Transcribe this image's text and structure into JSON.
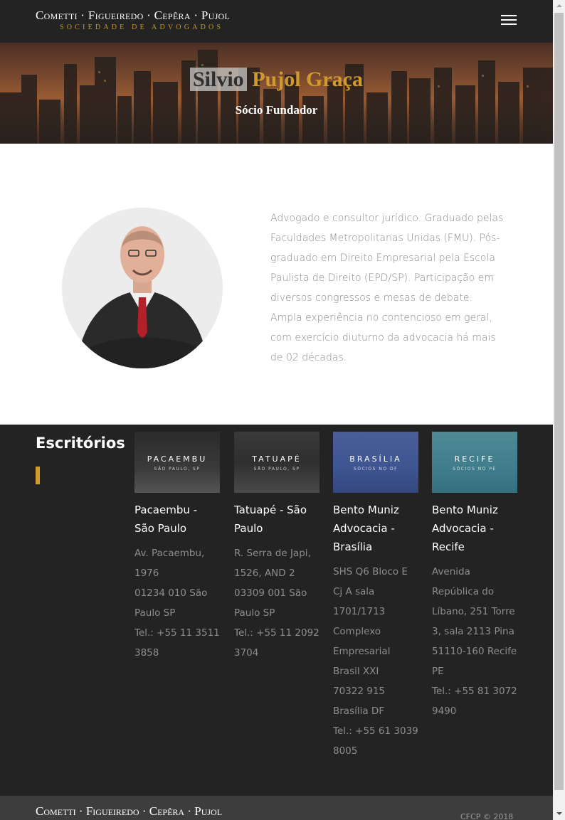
{
  "header": {
    "logo_name": "Cometti · Figueiredo · Cepêra · Pujol",
    "logo_sub": "Sociedade de Advogados",
    "menu_icon": "hamburger-menu-icon"
  },
  "hero": {
    "first_name": "Silvio",
    "last_name": "Pujol Graça",
    "subtitle": "Sócio Fundador"
  },
  "profile": {
    "bio": "Advogado e consultor jurídico. Graduado pelas Faculdades Metropolitanas Unidas (FMU). Pós-graduado em Direito Empresarial pela Escola Paulista de Direito (EPD/SP). Participação em diversos congressos e mesas de debate. Ampla experiência no contencioso em geral, com exercício diuturno da advocacia há mais de 02 décadas."
  },
  "offices": {
    "title": "Escritórios",
    "items": [
      {
        "thumb_city": "PACAEMBU",
        "thumb_sub": "SÃO PAULO, SP",
        "name": "Pacaembu - São Paulo",
        "address": "Av. Pacaembu, 1976\n01234 010 São Paulo SP\nTel.: +55 11 3511 3858"
      },
      {
        "thumb_city": "TATUAPÉ",
        "thumb_sub": "SÃO PAULO, SP",
        "name": "Tatuapé - São Paulo",
        "address": "R. Serra de Japi, 1526, AND 2\n03309 001 São Paulo SP\nTel.: +55 11 2092 3704"
      },
      {
        "thumb_city": "BRASÍLIA",
        "thumb_sub": "SÓCIOS NO DF",
        "name": "Bento Muniz Advocacia - Brasília",
        "address": "SHS Q6 Bloco E Cj A sala 1701/1713 Complexo Empresarial Brasil XXI\n70322 915 Brasília DF\nTel.: +55 61 3039 8005"
      },
      {
        "thumb_city": "RECIFE",
        "thumb_sub": "SÓCIOS NO PE",
        "name": "Bento Muniz Advocacia - Recife",
        "address": "Avenida República do Líbano, 251 Torre 3, sala 2113 Pina\n51110-160 Recife PE\nTel.: +55 81 3072 9490"
      }
    ]
  },
  "footer": {
    "logo_name": "Cometti · Figueiredo · Cepêra · Pujol",
    "copyright": "CFCP © 2018"
  },
  "colors": {
    "gold": "#d09a2e",
    "dark": "#232323"
  }
}
